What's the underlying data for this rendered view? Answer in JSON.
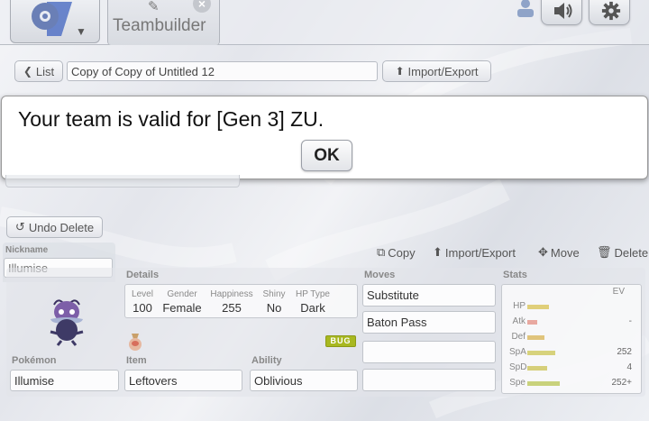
{
  "header": {
    "tab_title": "Teambuilder"
  },
  "toolbar": {
    "list_label": "List",
    "team_name": "Copy of Copy of Untitled 12",
    "import_export_label": "Import/Export"
  },
  "modal": {
    "message": "Your team is valid for [Gen 3] ZU.",
    "ok_label": "OK"
  },
  "undo_delete_label": "Undo Delete",
  "set_actions": {
    "copy": "Copy",
    "import_export": "Import/Export",
    "move": "Move",
    "delete": "Delete"
  },
  "pokemon": {
    "nickname_label": "Nickname",
    "nickname_placeholder": "Illumise",
    "details_label": "Details",
    "details": {
      "level_label": "Level",
      "level": "100",
      "gender_label": "Gender",
      "gender": "Female",
      "happiness_label": "Happiness",
      "happiness": "255",
      "shiny_label": "Shiny",
      "shiny": "No",
      "hp_type_label": "HP Type",
      "hp_type": "Dark"
    },
    "type_badge": "BUG",
    "pokemon_label": "Pokémon",
    "species": "Illumise",
    "item_label": "Item",
    "item": "Leftovers",
    "ability_label": "Ability",
    "ability": "Oblivious",
    "moves_label": "Moves",
    "moves": [
      "Substitute",
      "Baton Pass",
      "",
      ""
    ],
    "stats_label": "Stats",
    "ev_label": "EV",
    "stats": [
      {
        "name": "HP",
        "ev": "",
        "bar_fraction": 0.22,
        "color": "#e0cf7a"
      },
      {
        "name": "Atk",
        "ev": "-",
        "bar_fraction": 0.1,
        "color": "#e8a8a0"
      },
      {
        "name": "Def",
        "ev": "",
        "bar_fraction": 0.17,
        "color": "#e0c47c"
      },
      {
        "name": "SpA",
        "ev": "252",
        "bar_fraction": 0.28,
        "color": "#d7d27c"
      },
      {
        "name": "SpD",
        "ev": "4",
        "bar_fraction": 0.2,
        "color": "#d6cf7a"
      },
      {
        "name": "Spe",
        "ev": "252+",
        "bar_fraction": 0.33,
        "color": "#c9d27c"
      }
    ]
  },
  "colors": {
    "bug_badge": "#a8b820"
  }
}
